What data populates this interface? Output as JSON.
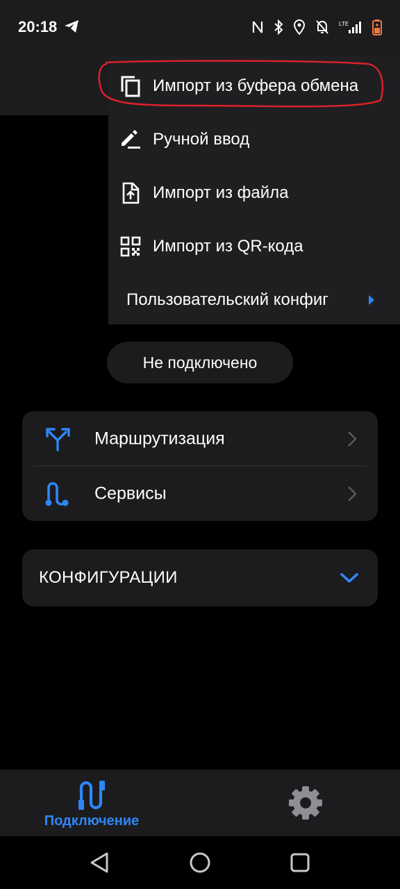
{
  "status_bar": {
    "time": "20:18",
    "icons": [
      "telegram-icon",
      "nfc-icon",
      "bluetooth-icon",
      "location-icon",
      "alarm-off-icon",
      "lte-signal-icon",
      "battery-icon"
    ]
  },
  "menu": {
    "items": [
      {
        "label": "Импорт из буфера обмена",
        "icon": "copy-icon"
      },
      {
        "label": "Ручной ввод",
        "icon": "edit-icon"
      },
      {
        "label": "Импорт из файла",
        "icon": "file-upload-icon"
      },
      {
        "label": "Импорт из QR-кода",
        "icon": "qr-code-icon"
      },
      {
        "label": "Пользовательский конфиг",
        "icon": "triangle-right-icon"
      }
    ]
  },
  "connection_status": "Не подключено",
  "routes_card": {
    "items": [
      {
        "label": "Маршрутизация",
        "icon": "routing-icon"
      },
      {
        "label": "Сервисы",
        "icon": "services-icon"
      }
    ]
  },
  "configs": {
    "label": "КОНФИГУРАЦИИ"
  },
  "bottom_nav": {
    "connection_label": "Подключение",
    "settings_icon": "gear-icon"
  },
  "colors": {
    "accent": "#2f86f5",
    "surface": "#1c1c1e",
    "menu_surface": "#1f1f21",
    "background": "#000000",
    "annotation": "#e0202a"
  }
}
